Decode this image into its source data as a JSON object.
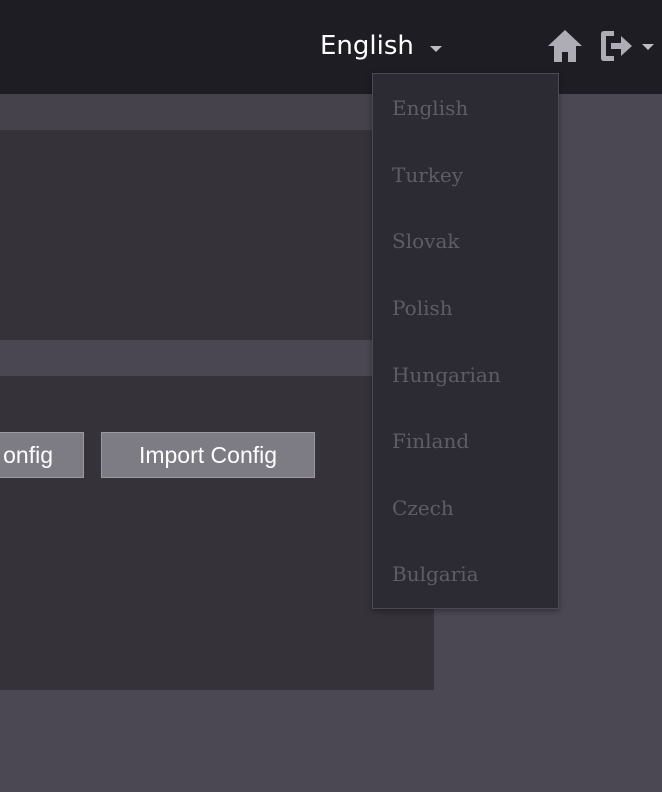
{
  "navbar": {
    "language": {
      "selected": "English",
      "options": [
        "English",
        "Turkey",
        "Slovak",
        "Polish",
        "Hungarian",
        "Finland",
        "Czech",
        "Bulgaria"
      ]
    },
    "icons": {
      "home": "home-icon",
      "logout": "logout-icon"
    }
  },
  "main": {
    "buttons": {
      "export_label": "onfig",
      "import_label": "Import Config"
    }
  },
  "colors": {
    "navbar_bg": "#1f1d24",
    "page_bg": "#4b4854",
    "panel_body": "#353339",
    "button_bg": "#7d7b83",
    "dropdown_bg": "#2c2b33",
    "dropdown_text": "#5e5c66"
  }
}
